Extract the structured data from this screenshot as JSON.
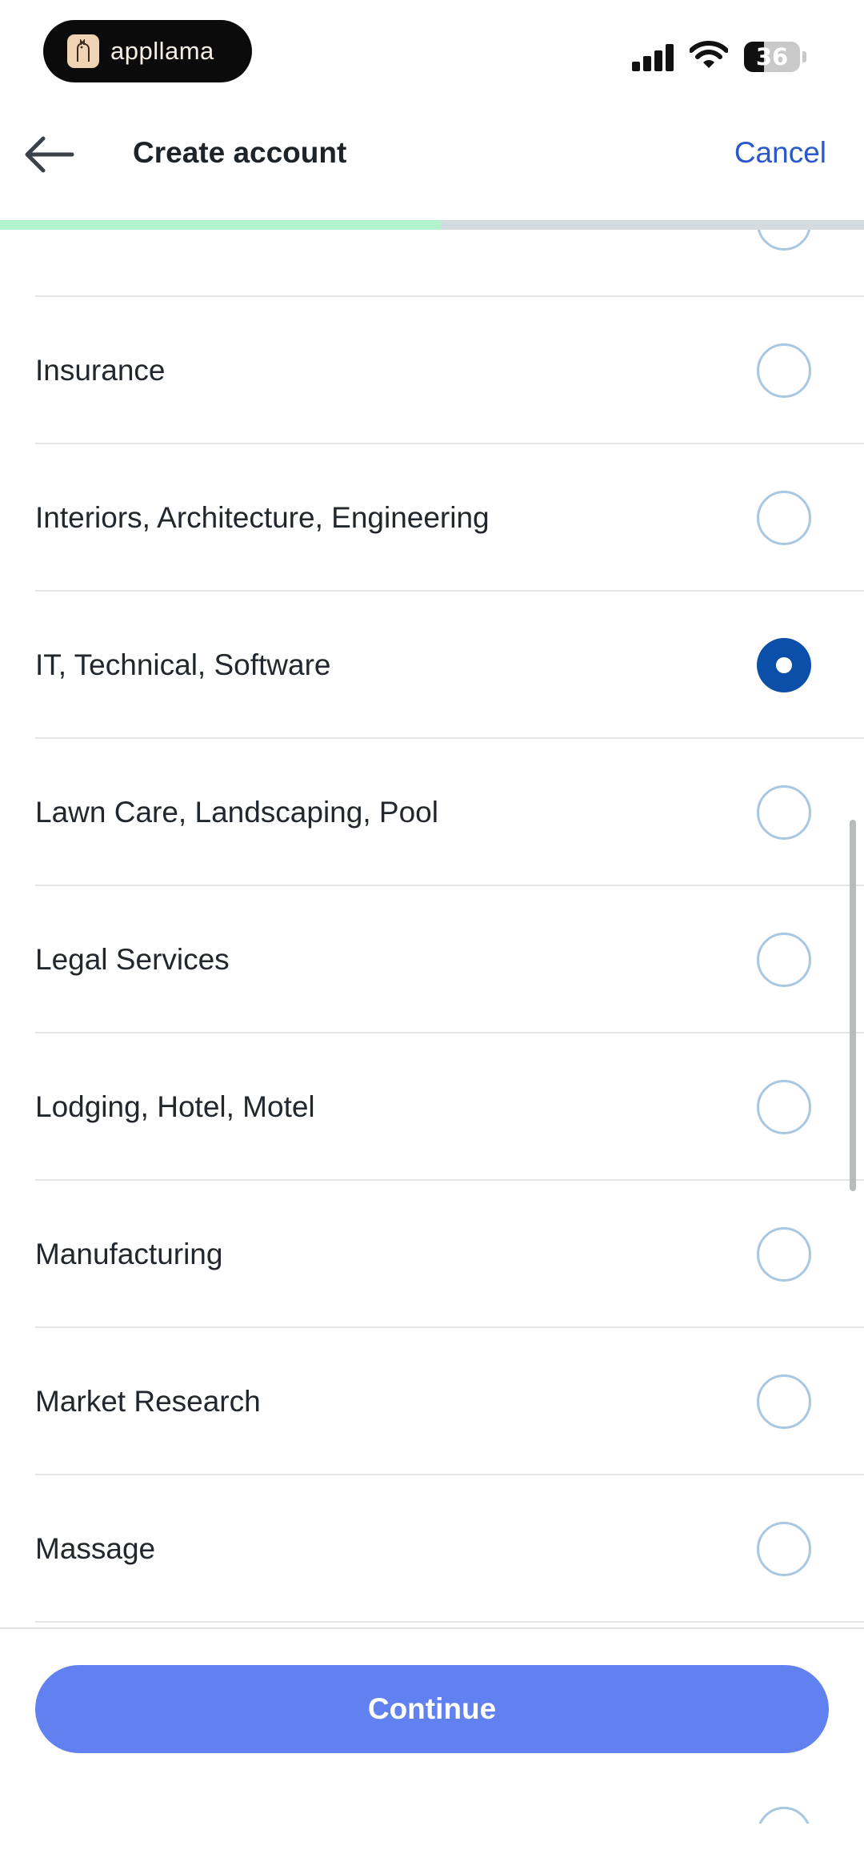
{
  "status_bar": {
    "brand_name": "appllama",
    "battery_level": "36",
    "icons": [
      "cellular-signal-icon",
      "wifi-icon",
      "battery-icon"
    ]
  },
  "header": {
    "title": "Create account",
    "cancel_label": "Cancel",
    "back_icon": "arrow-left-icon",
    "progress_fraction": 0.51
  },
  "options": [
    {
      "label": "",
      "selected": false
    },
    {
      "label": "Insurance",
      "selected": false
    },
    {
      "label": "Interiors, Architecture, Engineering",
      "selected": false
    },
    {
      "label": "IT, Technical, Software",
      "selected": true
    },
    {
      "label": "Lawn Care, Landscaping, Pool",
      "selected": false
    },
    {
      "label": "Legal Services",
      "selected": false
    },
    {
      "label": "Lodging, Hotel, Motel",
      "selected": false
    },
    {
      "label": "Manufacturing",
      "selected": false
    },
    {
      "label": "Market Research",
      "selected": false
    },
    {
      "label": "Massage",
      "selected": false
    }
  ],
  "footer": {
    "continue_label": "Continue"
  },
  "colors": {
    "accent_blue": "#0b4fa8",
    "button_blue": "#6281f0",
    "link_blue": "#2a58c9",
    "progress_green": "#b0f3cd"
  }
}
